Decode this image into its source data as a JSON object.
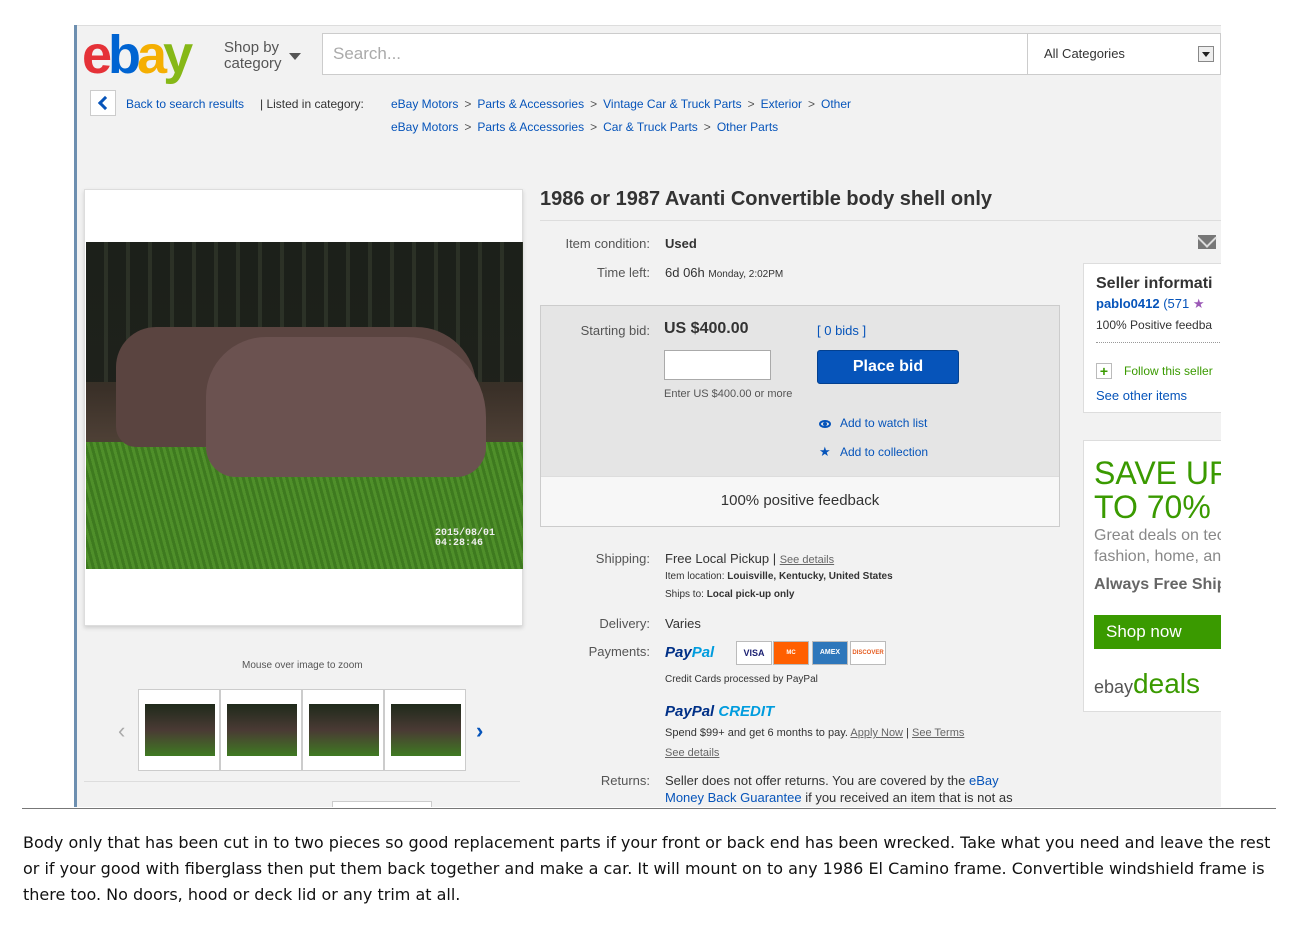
{
  "header": {
    "logo_letters": [
      "e",
      "b",
      "a",
      "y"
    ],
    "shop_by_line1": "Shop by",
    "shop_by_line2": "category",
    "search_placeholder": "Search...",
    "category_select": "All Categories"
  },
  "breadcrumb": {
    "back_label": "Back to search results",
    "listed_label": "| Listed in category:",
    "path1": [
      "eBay Motors",
      "Parts & Accessories",
      "Vintage Car & Truck Parts",
      "Exterior",
      "Other"
    ],
    "path2": [
      "eBay Motors",
      "Parts & Accessories",
      "Car & Truck Parts",
      "Other Parts"
    ],
    "separator": ">"
  },
  "gallery": {
    "photo_timestamp_date": "2015/08/01",
    "photo_timestamp_time": "04:28:46",
    "zoom_hint": "Mouse over image to zoom",
    "prev_arrow": "‹",
    "next_arrow": "›"
  },
  "listing": {
    "title": "1986 or 1987 Avanti Convertible body shell only",
    "condition_label": "Item condition:",
    "condition_value": "Used",
    "time_left_label": "Time left:",
    "time_left_value": "6d 06h",
    "time_left_end": "Monday, 2:02PM",
    "starting_bid_label": "Starting bid:",
    "starting_bid_value": "US $400.00",
    "bids_link": "[ 0 bids ]",
    "bid_hint": "Enter US $400.00 or more",
    "place_bid_label": "Place bid",
    "watch_label": "Add to watch list",
    "collection_label": "Add to collection",
    "feedback_banner": "100% positive feedback",
    "shipping_label": "Shipping:",
    "shipping_value": "Free Local Pickup",
    "shipping_sep": "|",
    "see_details": "See details",
    "item_location_label": "Item location:",
    "item_location_value": "Louisville, Kentucky, United States",
    "ships_to_label": "Ships to:",
    "ships_to_value": "Local pick-up only",
    "delivery_label": "Delivery:",
    "delivery_value": "Varies",
    "payments_label": "Payments:",
    "paypal_p1": "Pay",
    "paypal_p2": "Pal",
    "cards": [
      "VISA",
      "MC",
      "AMEX",
      "DISCOVER"
    ],
    "cards_note": "Credit Cards processed by PayPal",
    "credit_p1": "PayPal",
    "credit_p2": "CREDIT",
    "credit_offer": "Spend $99+ and get 6 months to pay.",
    "apply_now": "Apply Now",
    "credit_sep": "|",
    "see_terms": "See Terms",
    "credit_see_details": "See details",
    "returns_label": "Returns:",
    "returns_text1": "Seller does not offer returns. You are covered by the",
    "returns_link1": "eBay",
    "returns_link2": "Money Back Guarantee",
    "returns_text2": "if you received an item that is not as"
  },
  "seller": {
    "heading": "Seller informati",
    "name": "pablo0412",
    "score": "(571",
    "positive": "100% Positive feedba",
    "follow": "Follow this seller",
    "other_items": "See other items"
  },
  "ad": {
    "headline1": "SAVE UP",
    "headline2": "TO 70%",
    "line1": "Great deals on tech",
    "line2": "fashion, home, and",
    "line3": "Always Free Ship",
    "cta": "Shop now",
    "brand_ebay": "ebay",
    "brand_deals": "deals"
  },
  "caption": "Body only that has been cut in to two pieces so good replacement parts if your front or back end has been wrecked. Take what you need and leave the rest or if your good with fiberglass then put them back together and make a car. It will mount on to any 1986 El Camino frame. Convertible windshield frame is there too. No doors, hood or deck lid or any trim at all.",
  "colors": {
    "ebay_red": "#e53238",
    "ebay_blue": "#0654ba",
    "ebay_yellow": "#f5af02",
    "ebay_green": "#86b817",
    "deals_green": "#3a9a00"
  }
}
